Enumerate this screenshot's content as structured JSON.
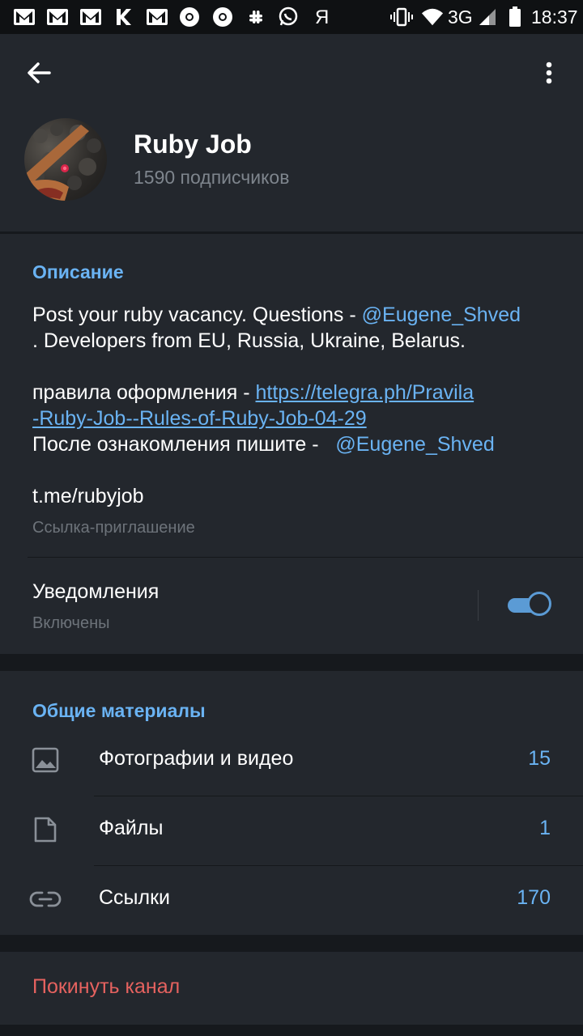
{
  "status_bar": {
    "time": "18:37",
    "network": "3G",
    "left_icons": [
      "gmail-icon",
      "gmail-icon",
      "gmail-icon",
      "k-icon",
      "gmail-icon",
      "chrome-icon",
      "chrome-icon",
      "slack-icon",
      "whatsapp-icon",
      "yandex-icon"
    ],
    "yandex_glyph": "Я"
  },
  "header": {
    "title": "Ruby Job",
    "subscribers": "1590 подписчиков"
  },
  "description": {
    "section_title": "Описание",
    "line1_text": "Post your ruby vacancy. Questions - ",
    "line1_mention": "@Eugene_Shved",
    "line2_text": ". Developers from EU, Russia, Ukraine, Belarus.",
    "line3_text": "правила оформления - ",
    "line3_link": "https://telegra.ph/Pravila",
    "line4_link": "-Ruby-Job--Rules-of-Ruby-Job-04-29",
    "line5_text": "После ознакомления пишите -   ",
    "line5_mention": "@Eugene_Shved"
  },
  "invite": {
    "link": "t.me/rubyjob",
    "label": "Ссылка-приглашение"
  },
  "notifications": {
    "title": "Уведомления",
    "status": "Включены",
    "enabled": true
  },
  "shared_media": {
    "section_title": "Общие материалы",
    "items": [
      {
        "label": "Фотографии и видео",
        "count": "15",
        "icon": "image-icon"
      },
      {
        "label": "Файлы",
        "count": "1",
        "icon": "file-icon"
      },
      {
        "label": "Ссылки",
        "count": "170",
        "icon": "link-icon"
      }
    ]
  },
  "leave": {
    "label": "Покинуть канал"
  },
  "colors": {
    "accent": "#6ab3f3",
    "danger": "#e5625f",
    "card_bg": "#23272d",
    "page_bg": "#16191d"
  }
}
